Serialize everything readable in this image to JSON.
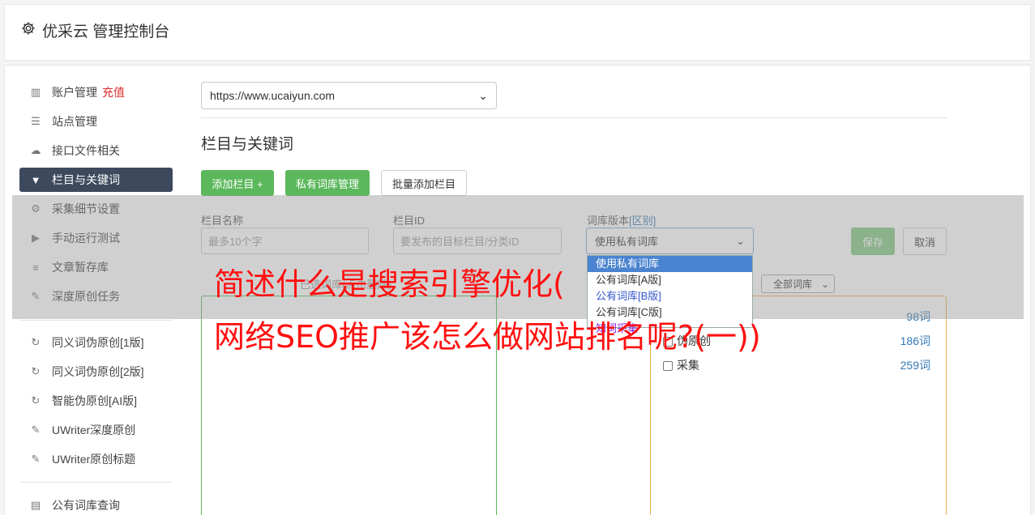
{
  "header": {
    "title": "优采云 管理控制台"
  },
  "sidebar": {
    "items": [
      {
        "label": "账户管理",
        "tag": "充值"
      },
      {
        "label": "站点管理"
      },
      {
        "label": "接口文件相关"
      },
      {
        "label": "栏目与关键词"
      },
      {
        "label": "采集细节设置"
      },
      {
        "label": "手动运行测试"
      },
      {
        "label": "文章暂存库"
      },
      {
        "label": "深度原创任务"
      },
      {
        "label": "同义词伪原创[1版]"
      },
      {
        "label": "同义词伪原创[2版]"
      },
      {
        "label": "智能伪原创[AI版]"
      },
      {
        "label": "UWriter深度原创"
      },
      {
        "label": "UWriter原创标题"
      },
      {
        "label": "公有词库查询"
      }
    ]
  },
  "main": {
    "site_select": "https://www.ucaiyun.com",
    "section_title": "栏目与关键词",
    "buttons": {
      "add_column": "添加栏目 +",
      "private_lib": "私有词库管理",
      "batch_add": "批量添加栏目",
      "save": "保存",
      "cancel": "取消"
    },
    "form": {
      "name_label": "栏目名称",
      "name_placeholder": "最多10个字",
      "id_label": "栏目ID",
      "id_placeholder": "要发布的目标栏目/分类ID",
      "lib_label": "词库版本",
      "lib_label_link": "[区别]",
      "lib_selected": "使用私有词库",
      "lib_options": [
        "使用私有词库",
        "公有词库[A版]",
        "公有词库[B版]",
        "公有词库[C版]",
        "知词采集"
      ]
    },
    "selected_hint": "已选词库(点击删除)",
    "filter_select": "全部词库",
    "libraries": [
      {
        "name": "",
        "count": "98词"
      },
      {
        "name": "伪原创",
        "count": "186词"
      },
      {
        "name": "采集",
        "count": "259词"
      }
    ]
  },
  "overlay": {
    "line1": "简述什么是搜索引擎优化(",
    "line2": "网络SEO推广该怎么做网站排名呢?(一))"
  },
  "colors": {
    "accent_green": "#5cb85c",
    "sidebar_active": "#3d4a5e",
    "headline_red": "#ff1010"
  }
}
